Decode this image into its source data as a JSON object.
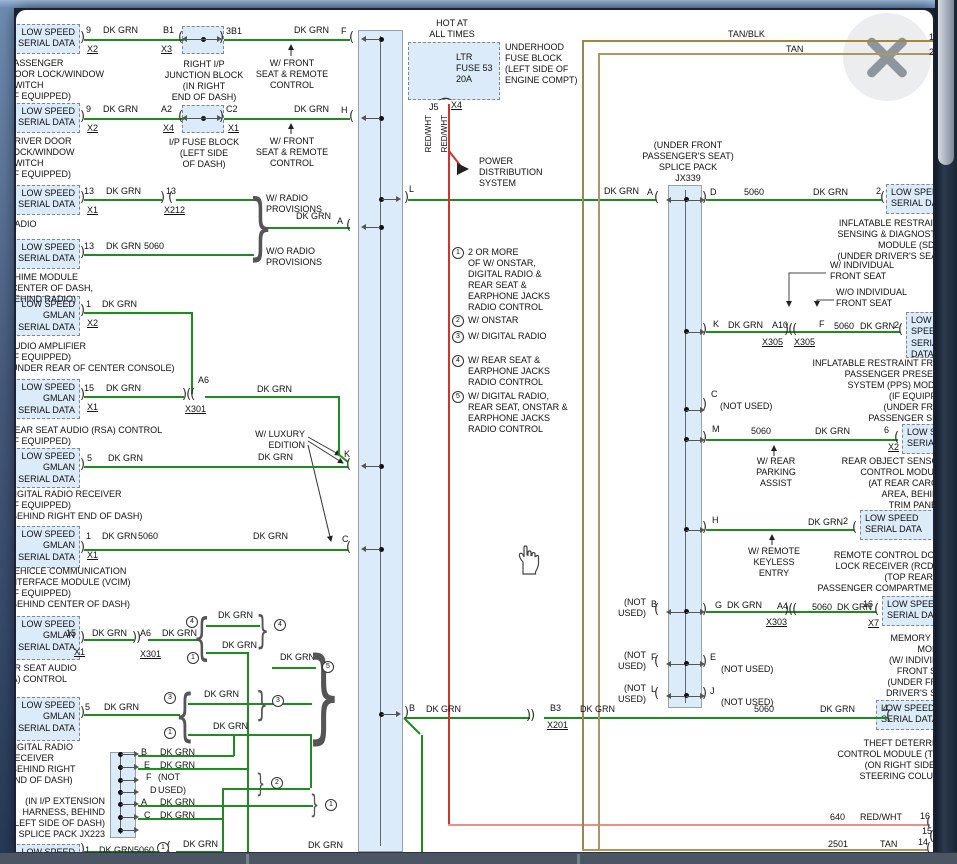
{
  "colors": {
    "wire_green": "#1f8c1f",
    "wire_red": "#d03333",
    "wire_red_light": "#e89090",
    "wire_tan": "#b3965c",
    "wire_tan_black": "#a08549",
    "box_fill": "#dcebf9",
    "frame_blue": "#6d8cb2"
  },
  "glyphs": {
    "o": "(",
    "c": ")",
    "dc": "))",
    "sp": ")((",
    "bo": "{",
    "bc": "}"
  },
  "t": {
    "dk_grn": "DK GRN",
    "red_wht": "RED/WHT",
    "tan": "TAN",
    "tan_blk": "TAN/BLK",
    "c5060": "5060",
    "c640": "640",
    "c2501": "2501",
    "p9": "9",
    "p13": "13",
    "p1": "1",
    "p15": "15",
    "p5": "5",
    "p2": "2",
    "p4": "4",
    "p6": "6",
    "p16": "16",
    "p14": "14",
    "p15r": "15",
    "p13r": "13",
    "p3b1": "3B1",
    "n1": "1",
    "n2": "2",
    "A": "A",
    "B": "B",
    "C": "C",
    "D": "D",
    "E": "E",
    "F": "F",
    "G": "G",
    "H": "H",
    "J": "J",
    "K": "K",
    "L": "L",
    "M": "M",
    "A2": "A2",
    "B1": "B1",
    "C2": "C2",
    "B3": "B3",
    "A4": "A4",
    "A6": "A6",
    "A10": "A10",
    "J5": "J5",
    "X1": "X1",
    "X2": "X2",
    "X3": "X3",
    "X4": "X4",
    "X7": "X7",
    "X212": "X212",
    "X201": "X201",
    "X301": "X301",
    "X303": "X303",
    "X305": "X305",
    "not_used": "(NOT USED)",
    "not_used_2l": "(NOT\nUSED)",
    "not_open": "(NOT",
    "used_close": "USED)"
  },
  "boxes": {
    "low_speed": "LOW SPEED\nSERIAL DATA",
    "gmlan": "LOW SPEED\nGMLAN\nSERIAL DATA",
    "low_speed_4l": "LOW\nSPEED\nSERIAL\nDATA"
  },
  "f": {
    "hot": "HOT AT\nALL TIMES",
    "fuse": "LTR\nFUSE 53\n20A",
    "underhood": "UNDERHOOD\nFUSE BLOCK\n(LEFT SIDE OF\nENGINE COMPT)",
    "power": "POWER\nDISTRIBUTION\nSYSTEM"
  },
  "q": {
    "w_front": "W/ FRONT\nSEAT & REMOTE\nCONTROL",
    "w_radio": "W/ RADIO\nPROVISIONS",
    "wo_radio": "W/O RADIO\nPROVISIONS",
    "w_luxury": "W/ LUXURY\nEDITION",
    "w_ind": "W/ INDIVIDUAL\nFRONT SEAT",
    "wo_ind": "W/O INDIVIDUAL\nFRONT SEAT",
    "w_rear_park": "W/ REAR\nPARKING\nASSIST",
    "w_rke": "W/ REMOTE\nKEYLESS\nENTRY"
  },
  "b": {
    "right_ip": "RIGHT I/P\nJUNCTION BLOCK\n(IN RIGHT\nEND OF DASH)",
    "ip_fuse": "I/P FUSE BLOCK\n(LEFT SIDE\nOF DASH)",
    "jx339": "(UNDER FRONT\nPASSENGER'S SEAT)\nSPLICE PACK\nJX339",
    "jx223": "(IN I/P EXTENSION\nHARNESS, BEHIND\nLEFT SIDE OF DASH)\nSPLICE PACK JX223"
  },
  "m": {
    "passenger": "PASSENGER\nDOOR LOCK/WINDOW\nSWITCH\n(IF EQUIPPED)",
    "driver": "DRIVER DOOR\nLOCK/WINDOW\nSWITCH\n(IF EQUIPPED)",
    "radio": "RADIO",
    "chime": "CHIME MODULE\n(CENTER OF DASH,\nBEHIND RADIO)",
    "amp": "AUDIO AMPLIFIER\n(IF EQUIPPED)\n(UNDER REAR OF CENTER CONSOLE)",
    "rsa": "REAR SEAT AUDIO (RSA) CONTROL\n(IF EQUIPPED)",
    "digradio": "DIGITAL RADIO RECEIVER\n(IF EQUIPPED)\n(BEHIND RIGHT END OF DASH)",
    "vcim": "VEHICLE COMMUNICATION\nINTERFACE MODULE (VCIM)\n(IF EQUIPPED)\n(BEHIND CENTER OF DASH)",
    "rsa2": "REAR SEAT AUDIO\n(RSA) CONTROL",
    "digradio2": "DIGITAL RADIO\nRECEIVER\n(BEHIND RIGHT\nEND OF DASH)",
    "sdm": "INFLATABLE RESTRAINT\nSENSING & DIAGNOSTIC\nMODULE (SDM)\n(UNDER DRIVER'S SEAT)",
    "pps": "INFLATABLE RESTRAINT FRONT\nPASSENGER PRESENCE\nSYSTEM (PPS) MODULE\n(IF EQUIPPED)\n(UNDER FRONT\nPASSENGER SEAT)",
    "rear_obj": "REAR OBJECT SENSOR\nCONTROL MODULE\n(AT REAR CARGO\nAREA, BEHIND\nTRIM PANEL)",
    "rcdlr": "REMOTE CONTROL DOOR\nLOCK RECEIVER (RCDLR)\n(TOP REAR OF\nPASSENGER COMPARTMENT)",
    "memory": "MEMORY SEAT\nMODULE\n(W/ INDIVIDUAL\nFRONT SEAT)\n(UNDER FRONT\nDRIVER'S SEAT)",
    "tdm": "THEFT DETERRENT\nCONTROL MODULE (TDM)\n(ON RIGHT SIDE OF\nSTEERING COLUMN)"
  },
  "n": {
    "n1": "2 OR MORE\nOF W/ ONSTAR,\nDIGITAL RADIO &\nREAR SEAT &\nEARPHONE JACKS\nRADIO CONTROL",
    "n2": "W/ ONSTAR",
    "n3": "W/ DIGITAL RADIO",
    "n4": "W/ REAR SEAT &\nEARPHONE JACKS\nRADIO CONTROL",
    "n5": "W/ DIGITAL RADIO,\nREAR SEAT, ONSTAR &\nEARPHONE JACKS\nRADIO CONTROL"
  },
  "circled": {
    "c1": "1",
    "c2": "2",
    "c3": "3",
    "c4": "4",
    "c5": "5"
  }
}
